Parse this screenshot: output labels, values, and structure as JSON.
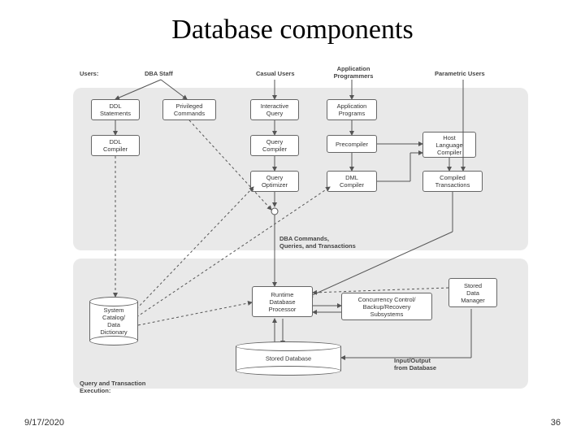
{
  "title": "Database components",
  "footer": {
    "date": "9/17/2020",
    "page": "36"
  },
  "labels": {
    "users": "Users:",
    "dba_staff": "DBA Staff",
    "casual": "Casual Users",
    "app_prog": "Application\nProgrammers",
    "param": "Parametric Users",
    "qt_exec": "Query and Transaction\nExecution:",
    "dba_cmds": "DBA Commands,\nQueries, and Transactions",
    "io_db": "Input/Output\nfrom Database"
  },
  "boxes": {
    "ddl_stmt": "DDL\nStatements",
    "priv_cmd": "Privileged\nCommands",
    "int_query": "Interactive\nQuery",
    "app_prog_box": "Application\nPrograms",
    "ddl_comp": "DDL\nCompiler",
    "query_comp": "Query\nCompiler",
    "precomp": "Precompiler",
    "host_comp": "Host\nLanguage\nCompiler",
    "query_opt": "Query\nOptimizer",
    "dml_comp": "DML\nCompiler",
    "compiled_tx": "Compiled\nTransactions",
    "runtime": "Runtime\nDatabase\nProcessor",
    "concur": "Concurrency Control/\nBackup/Recovery\nSubsystems",
    "sdm": "Stored\nData\nManager"
  },
  "cylinders": {
    "catalog": "System\nCatalog/\nData\nDictionary",
    "stored_db": "Stored Database"
  }
}
